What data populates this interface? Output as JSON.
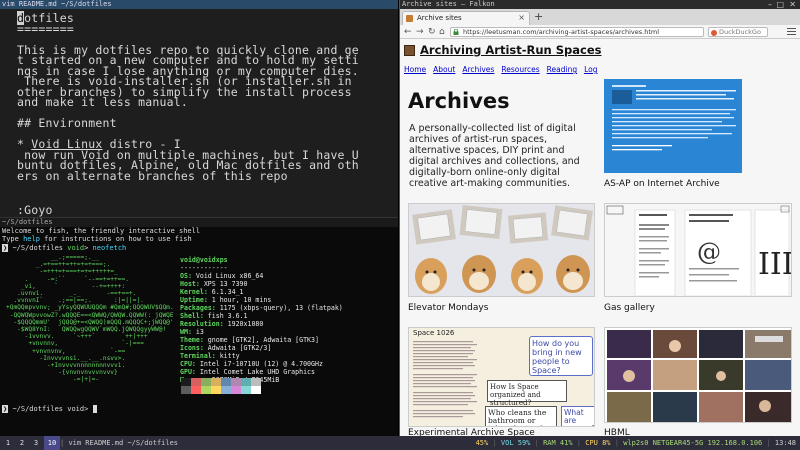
{
  "vim": {
    "titlebar": "vim README.md ~/S/dotfiles",
    "lines": [
      "dotfiles",
      "========",
      "",
      "This is my dotfiles repo to quickly clone and ge",
      "t started on a new computer and to hold my setti",
      "ngs in case I lose anything or my computer dies.",
      " There is void-installer.sh (or installer.sh in",
      "other branches) to simplify the install process",
      "and make it less manual.",
      "",
      "## Environment",
      "",
      "* Void Linux distro - I",
      " now run Void on multiple machines, but I have U",
      "buntu dotfiles, Alpine, old Mac dotfiles and oth",
      "ers on alternate branches of this repo",
      "",
      "",
      ":Goyo"
    ]
  },
  "terminal": {
    "titlebar": "~/S/dotfiles",
    "lines": [
      "Welcome to fish, the friendly interactive shell",
      "Type help for instructions on how to use fish",
      "~/S/dotfiles void>  neofetch"
    ],
    "prompt_user": "~/S/dotfiles",
    "prompt_host": "void",
    "cmd": "neofetch",
    "hostline": "void@voidxps",
    "separator": "------------",
    "info": [
      {
        "k": "OS",
        "v": "Void Linux x86_64"
      },
      {
        "k": "Host",
        "v": "XPS 13 7390"
      },
      {
        "k": "Kernel",
        "v": "6.1.34_1"
      },
      {
        "k": "Uptime",
        "v": "1 hour, 10 mins"
      },
      {
        "k": "Packages",
        "v": "1175 (xbps-query), 13 (flatpak)"
      },
      {
        "k": "Shell",
        "v": "fish 3.6.1"
      },
      {
        "k": "Resolution",
        "v": "1920x1080"
      },
      {
        "k": "WM",
        "v": "i3"
      },
      {
        "k": "Theme",
        "v": "gnome [GTK2], Adwaita [GTK3]"
      },
      {
        "k": "Icons",
        "v": "Adwaita [GTK2/3]"
      },
      {
        "k": "Terminal",
        "v": "kitty"
      },
      {
        "k": "CPU",
        "v": "Intel i7-10710U (12) @ 4.700GHz"
      },
      {
        "k": "GPU",
        "v": "Intel Comet Lake UHD Graphics"
      },
      {
        "k": "Memory",
        "v": "2878MiB / 7645MiB"
      }
    ],
    "swatches": [
      "#1c1c1c",
      "#d75f5f",
      "#87af5f",
      "#d7af5f",
      "#5f87af",
      "#af87af",
      "#5fafaf",
      "#bcbcbc",
      "#5c5c5c",
      "#ff5f5f",
      "#afd75f",
      "#ffd75f",
      "#87afd7",
      "#d787d7",
      "#87d7d7",
      "#ffffff"
    ],
    "final_prompt": "~/S/dotfiles void>"
  },
  "browser": {
    "titlebar": "Archive sites — Falkon",
    "tab_label": "Archive sites",
    "url": "https://leetusman.com/archiving-artist-spaces/archives.html",
    "search_placeholder": "DuckDuckGo",
    "site_title": "Archiving Artist-Run Spaces",
    "nav": [
      "Home",
      "About",
      "Archives",
      "Resources",
      "Reading",
      "Log"
    ],
    "heading": "Archives",
    "intro": "A personally-collected list of digital archives of artist-run spaces, alternative spaces, DIY print and digital archives and collections, and digitally-born online-only digital creative art-making communities.",
    "items": [
      {
        "caption": "AS-AP on Internet Archive"
      },
      {
        "caption": "Elevator Mondays"
      },
      {
        "caption": "Gas gallery"
      },
      {
        "caption": "Experimental Archive Space"
      },
      {
        "caption": "HBML"
      }
    ],
    "space_texts": {
      "badge": "Space 1026",
      "q1": "How do you bring in new people to Space?",
      "q2": "How Is Space organized and structured?",
      "q3": "Who cleans the bathroom or takes the trash out?",
      "q4": "What are some of the"
    }
  },
  "statusbar": {
    "workspaces": [
      "1",
      "2",
      "3",
      "10"
    ],
    "active_workspace": "10",
    "window_title": "vim README.md ~/S/dotfiles",
    "vol": "VOL 59%",
    "ram": "RAM 41%",
    "cpu": "CPU  8%",
    "net": "wlp2s0 NETGEAR45-5G 192.168.0.106",
    "battery": "45%",
    "time": "13:48"
  },
  "colors": {
    "accent": "#4a4a8a",
    "link": "#0000cc",
    "terminal_green": "#5fd75f",
    "terminal_cyan": "#46d9ff"
  }
}
